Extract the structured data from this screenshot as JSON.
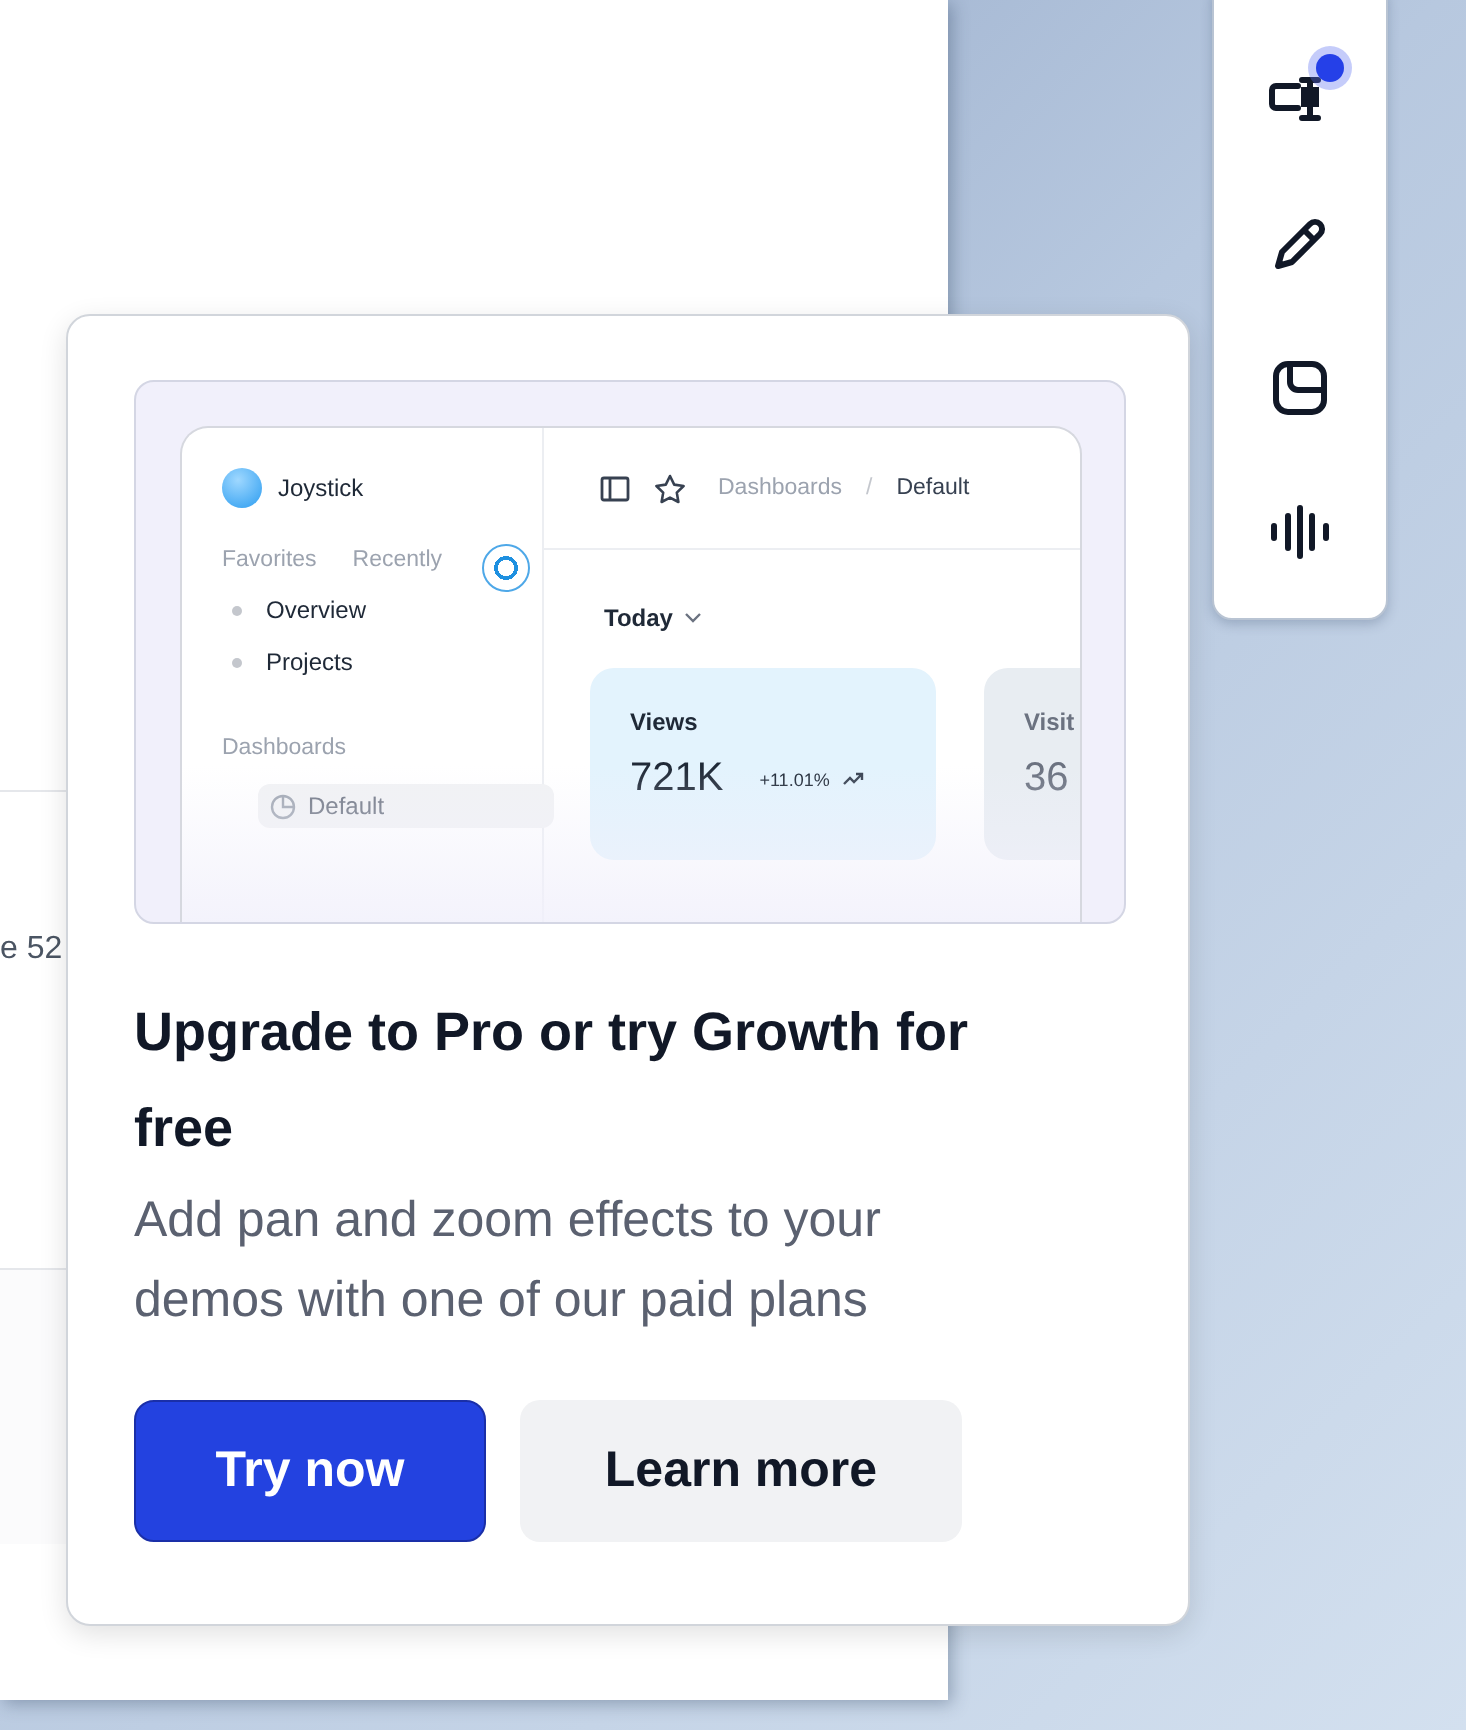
{
  "background_window": {
    "text": "e 52"
  },
  "toolbar": {
    "items": [
      {
        "kind": "microphone",
        "notification": true
      },
      {
        "kind": "pen",
        "notification": false
      },
      {
        "kind": "sticker",
        "notification": false
      },
      {
        "kind": "waveform",
        "notification": false
      }
    ]
  },
  "popup": {
    "preview": {
      "app_name": "Joystick",
      "sidebar_tabs": [
        "Favorites",
        "Recently"
      ],
      "favorites": [
        "Overview",
        "Projects"
      ],
      "section": "Dashboards",
      "dashboards": [
        {
          "label": "Default",
          "selected": true
        }
      ],
      "breadcrumb": [
        "Dashboards",
        "Default"
      ],
      "separator": "/",
      "period": "Today",
      "cards": [
        {
          "label": "Views",
          "value": "721K",
          "change": "+11.01%"
        },
        {
          "label": "Visit",
          "value": "36"
        }
      ]
    },
    "title": "Upgrade to Pro or try Growth for free",
    "description": "Add pan and zoom effects to your demos with one of our paid plans",
    "buttons": [
      {
        "label": "Try now",
        "kind": "primary"
      },
      {
        "label": "Learn more",
        "kind": "secondary"
      }
    ]
  }
}
